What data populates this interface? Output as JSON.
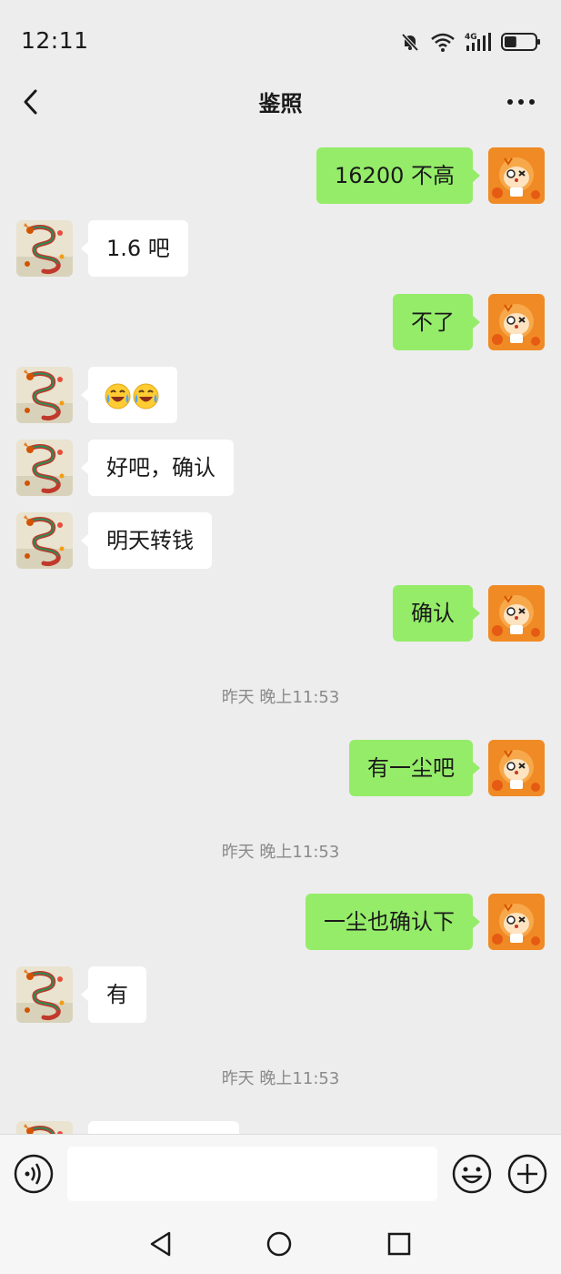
{
  "status_bar": {
    "time": "12:11",
    "network": "4G",
    "battery_percent": 40
  },
  "header": {
    "title": "鉴照",
    "back_icon": "chevron-left-icon",
    "more_icon": "more-dots-icon"
  },
  "messages": [
    {
      "side": "self",
      "text": "16200 不高"
    },
    {
      "side": "other",
      "text": "1.6 吧"
    },
    {
      "side": "self",
      "text": "不了"
    },
    {
      "side": "other",
      "text": "",
      "emoji": [
        "laughing-crying-emoji",
        "laughing-crying-emoji"
      ]
    },
    {
      "side": "other",
      "text": "好吧，确认"
    },
    {
      "side": "other",
      "text": "明天转钱"
    },
    {
      "side": "self",
      "text": "确认"
    },
    {
      "side": "time",
      "text": "昨天 晚上11:53"
    },
    {
      "side": "self",
      "text": "有一尘吧"
    },
    {
      "side": "time",
      "text": "昨天 晚上11:53"
    },
    {
      "side": "self",
      "text": "一尘也确认下"
    },
    {
      "side": "other",
      "text": "有"
    },
    {
      "side": "time",
      "text": "昨天 晚上11:53"
    }
  ],
  "input_bar": {
    "voice_icon": "voice-icon",
    "placeholder": "",
    "emoji_icon": "smiley-icon",
    "plus_icon": "plus-icon"
  },
  "nav_bar": {
    "back_icon": "triangle-back-icon",
    "home_icon": "circle-home-icon",
    "recent_icon": "square-recent-icon"
  },
  "colors": {
    "self_bubble": "#95ec69",
    "other_bubble": "#ffffff",
    "background": "#ededed"
  }
}
